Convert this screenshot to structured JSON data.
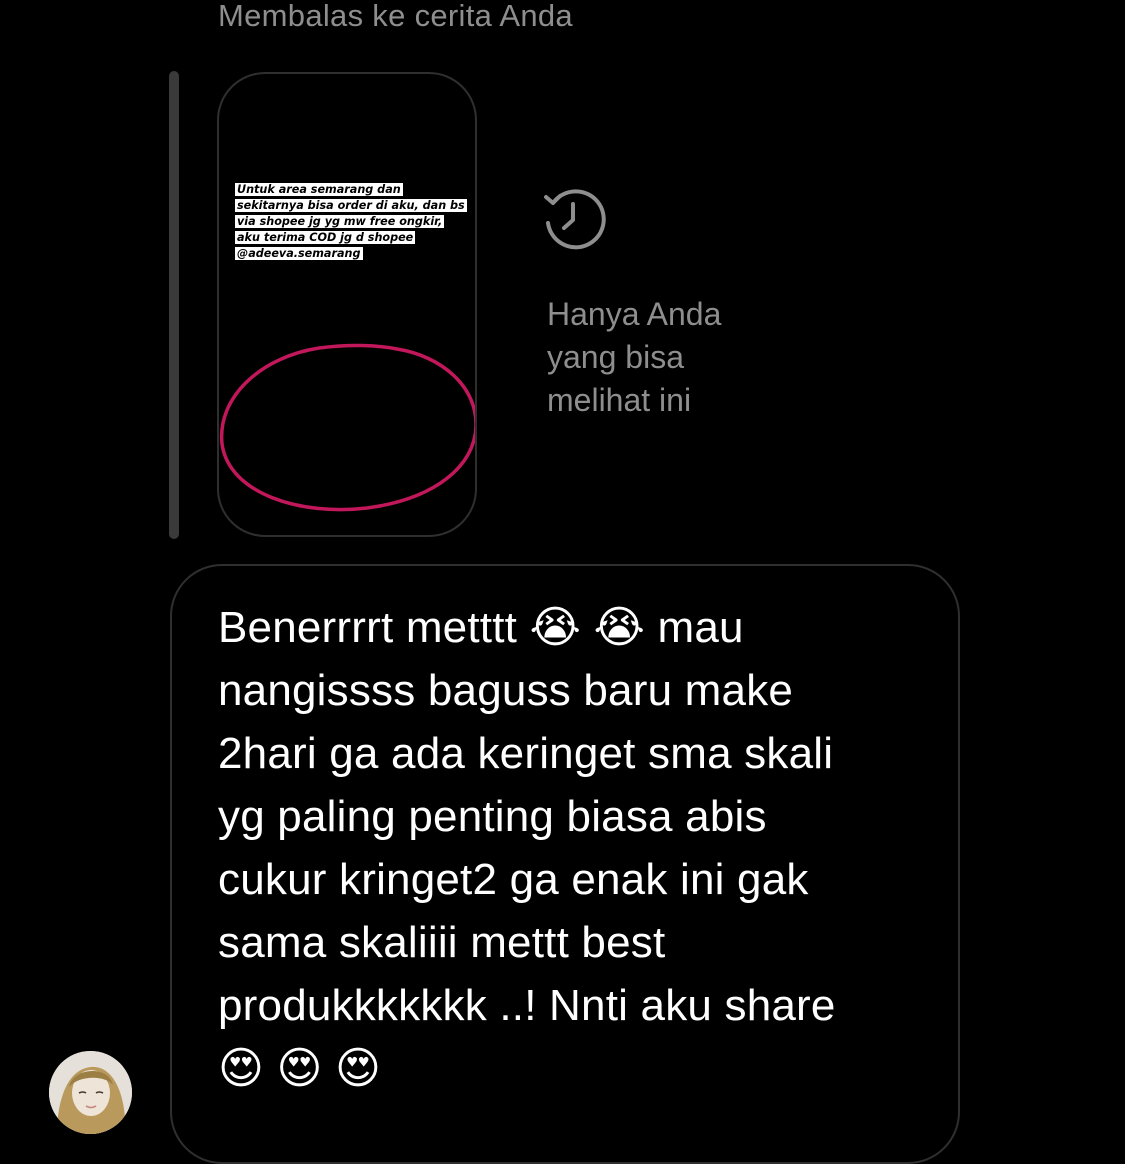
{
  "reply_context": {
    "header": "Membalas ke cerita Anda"
  },
  "story_preview": {
    "text": "Untuk area semarang dan sekitarnya bisa order di aku, dan bs via shopee jg yg mw free ongkir, aku terima COD jg d shopee @adeeva.semarang",
    "circle_color": "#c2185b"
  },
  "private_note": {
    "icon": "history-icon",
    "text": "Hanya Anda\nyang bisa\nmelihat ini"
  },
  "message": {
    "text": "Benerrrrt metttt 😭 😭  mau\nnangissss baguss baru make\n2hari ga ada keringet sma skali\nyg paling penting biasa abis\ncukur  kringet2 ga enak ini gak\nsama skaliiii mettt best\nprodukkkkkkk ..! Nnti aku share\n😍 😍 😍"
  },
  "sender": {
    "avatar": "avatar"
  }
}
